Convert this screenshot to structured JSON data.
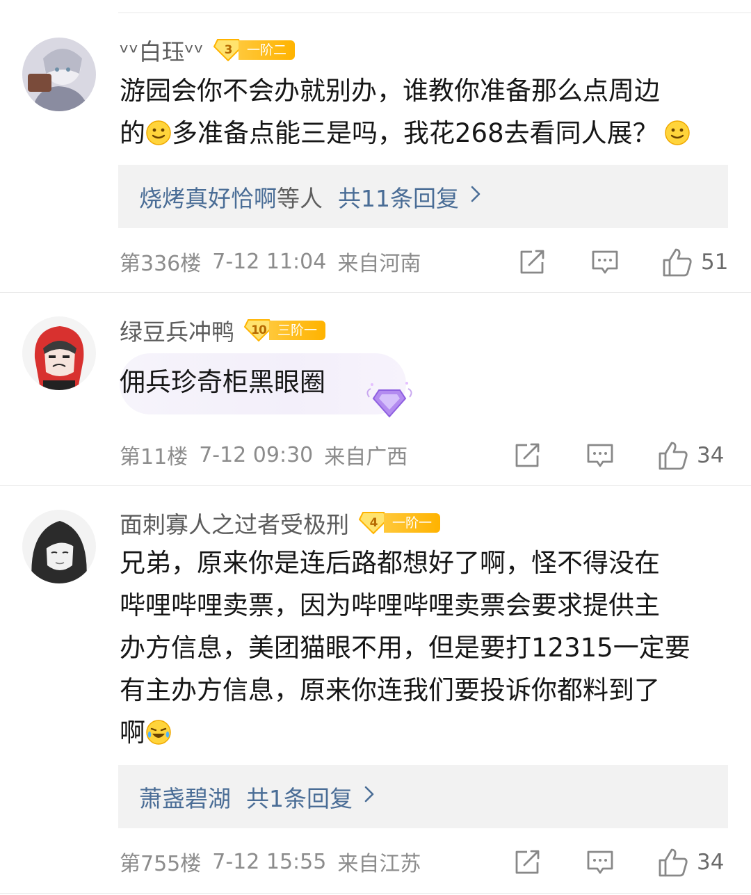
{
  "comments": [
    {
      "username": "ᵛᵛ白珏ᵛᵛ",
      "badge_level": "3",
      "badge_label": "一阶二",
      "text_lines": [
        "游园会你不会办就别办，谁教你准备那么点周边",
        "的",
        "多准备点能三是吗，我花268去看同人展？"
      ],
      "reply_name": "烧烤真好恰啊",
      "reply_etc": "等人",
      "reply_count": "共11条回复",
      "floor": "第336楼",
      "time": "7-12 11:04",
      "location": "来自河南",
      "likes": "51"
    },
    {
      "username": "绿豆兵冲鸭",
      "badge_level": "10",
      "badge_label": "三阶一",
      "text": "佣兵珍奇柜黑眼圈",
      "floor": "第11楼",
      "time": "7-12 09:30",
      "location": "来自广西",
      "likes": "34"
    },
    {
      "username": "面刺寡人之过者受极刑",
      "badge_level": "4",
      "badge_label": "一阶一",
      "text_lines": [
        "兄弟，原来你是连后路都想好了啊，怪不得没在",
        "哔哩哔哩卖票，因为哔哩哔哩卖票会要求提供主",
        "办方信息，美团猫眼不用，但是要打12315一定要",
        "有主办方信息，原来你连我们要投诉你都料到了",
        "啊"
      ],
      "reply_name": "萧盏碧湖",
      "reply_count": "共1条回复",
      "floor": "第755楼",
      "time": "7-12 15:55",
      "location": "来自江苏",
      "likes": "34"
    }
  ],
  "icons": {
    "share": "share-icon",
    "comment": "comment-icon",
    "like": "thumbs-up-icon",
    "reply_arrow": "chevron-right-icon",
    "smile": "smile-emoji-icon",
    "laugh_cry": "laugh-cry-emoji-icon",
    "gem": "diamond-gem-icon"
  },
  "colors": {
    "link": "#4a6d96",
    "meta": "#8c8c8c",
    "badge": "#ffb300"
  }
}
